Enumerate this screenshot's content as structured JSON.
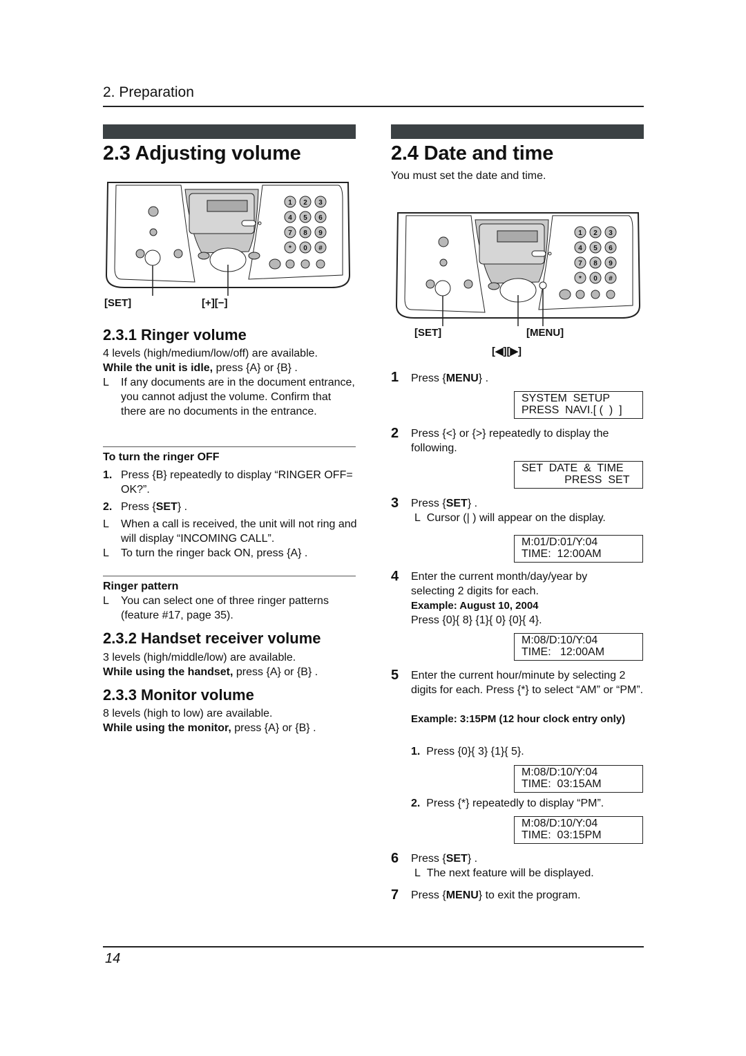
{
  "header": {
    "chapter": "2. Preparation"
  },
  "footer": {
    "page_number": "14"
  },
  "left": {
    "title": "2.3 Adjusting volume",
    "illustration": {
      "labels": [
        "[SET]",
        "[+][−]"
      ],
      "keypad": [
        "1",
        "2",
        "3",
        "4",
        "5",
        "6",
        "7",
        "8",
        "9",
        "*",
        "0",
        "#"
      ]
    },
    "ringer": {
      "title": "2.3.1 Ringer volume",
      "line1": "4 levels (high/medium/low/off) are available.",
      "line2_bold": "While the unit is idle,",
      "line2_rest": " press {A}   or {B}  .",
      "note_mark": "L",
      "note": "If any documents are in the document entrance, you cannot adjust the volume. Confirm that there are no documents in the entrance.",
      "off_title": "To turn the ringer OFF",
      "off_steps": [
        {
          "num": "1.",
          "text": "Press {B}   repeatedly to display “RINGER OFF= OK?”."
        },
        {
          "num": "2.",
          "pre": "Press {",
          "bold": "SET",
          "post": "} ."
        }
      ],
      "off_notes": [
        "When a call is received, the unit will not ring and will display “INCOMING CALL”.",
        "To turn the ringer back ON, press {A}  ."
      ],
      "pattern_title": "Ringer pattern",
      "pattern_note": "You can select one of three ringer patterns (feature #17, page 35)."
    },
    "handset": {
      "title": "2.3.2 Handset receiver volume",
      "line1": "3 levels (high/middle/low) are available.",
      "line2_bold": "While using the handset,",
      "line2_rest": " press {A}   or {B}  ."
    },
    "monitor": {
      "title": "2.3.3 Monitor volume",
      "line1": "8 levels (high to low) are available.",
      "line2_bold": "While using the monitor,",
      "line2_rest": " press {A}   or {B}  ."
    }
  },
  "right": {
    "title": "2.4 Date and time",
    "intro": "You must set the date and time.",
    "illustration": {
      "labels": [
        "[SET]",
        "[MENU]",
        "[◀][▶]"
      ]
    },
    "steps": [
      {
        "num": "1",
        "pre": "Press {",
        "bold": "MENU",
        "post": "} .",
        "lcd": [
          "SYSTEM  SETUP",
          "PRESS  NAVI.[ (  )  ]"
        ]
      },
      {
        "num": "2",
        "text": "Press {<}    or {>}    repeatedly to display the following.",
        "lcd": [
          "SET  DATE  &  TIME",
          "              PRESS  SET"
        ]
      },
      {
        "num": "3",
        "pre": "Press {",
        "bold": "SET",
        "post": "} .",
        "note": "Cursor (|  ) will appear on the display.",
        "lcd": [
          "M:01/D:01/Y:04",
          "TIME:  12:00AM"
        ]
      },
      {
        "num": "4",
        "text": "Enter the current month/day/year by selecting 2 digits for each.",
        "example": "Example: August 10, 2004",
        "press": "Press {0}{ 8} {1}{ 0} {0}{ 4}.",
        "lcd": [
          "M:08/D:10/Y:04",
          "TIME:   12:00AM"
        ]
      },
      {
        "num": "5",
        "text": "Enter the current hour/minute by selecting 2 digits for each. Press {*}     to select “AM” or “PM”.",
        "example": "Example: 3:15PM (12 hour clock entry only)",
        "sub": [
          {
            "num": "1.",
            "text": "Press {0}{ 3} {1}{ 5}.",
            "lcd": [
              "M:08/D:10/Y:04",
              "TIME:  03:15AM"
            ]
          },
          {
            "num": "2.",
            "text": "Press {*}     repeatedly to display “PM”.",
            "lcd": [
              "M:08/D:10/Y:04",
              "TIME:  03:15PM"
            ]
          }
        ]
      },
      {
        "num": "6",
        "pre": "Press {",
        "bold": "SET",
        "post": "} .",
        "note": "The next feature will be displayed."
      },
      {
        "num": "7",
        "pre": "Press {",
        "bold": "MENU",
        "post": "}  to exit the program."
      }
    ]
  }
}
